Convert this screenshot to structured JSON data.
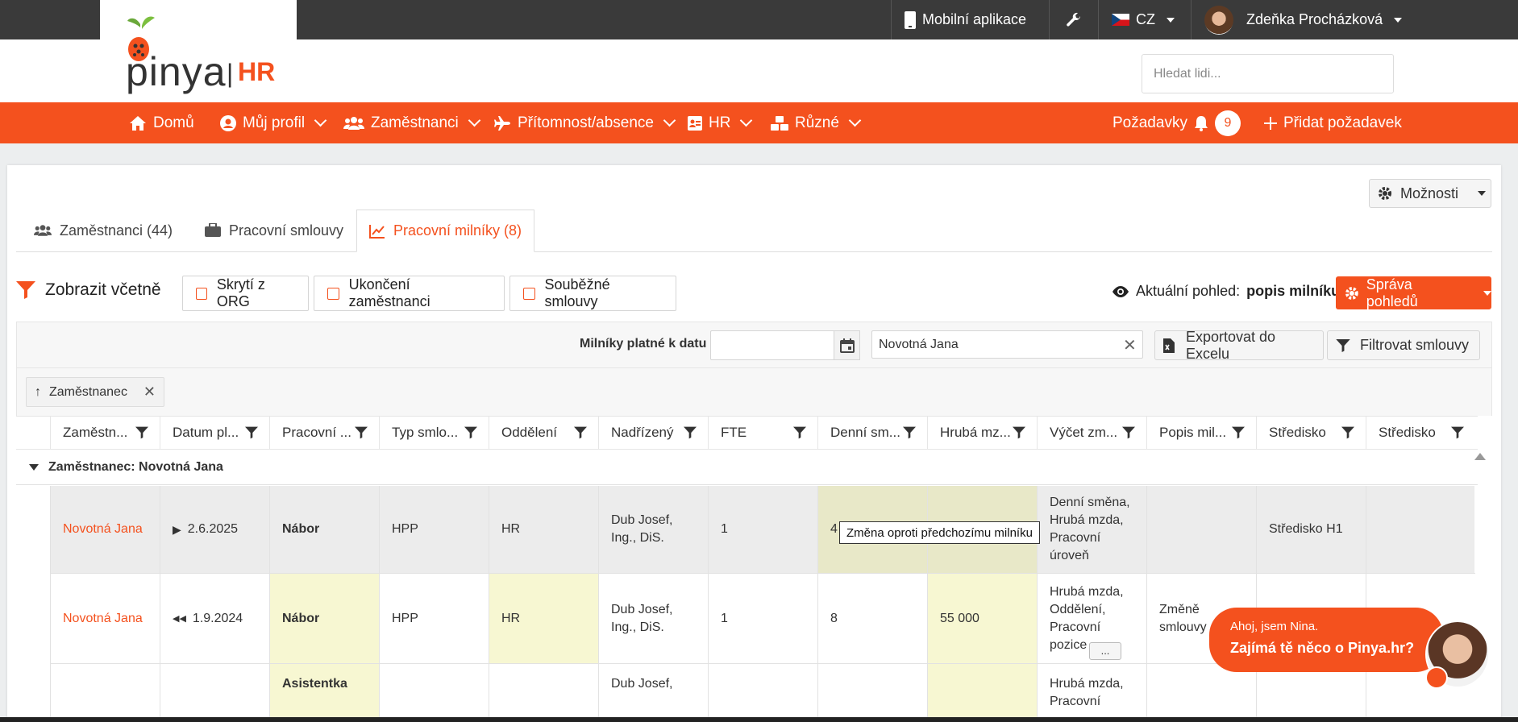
{
  "topbar": {
    "mobile_app": "Mobilní aplikace",
    "lang": "CZ",
    "user_name": "Zdeňka Procházková"
  },
  "logo": {
    "brand": "pinya",
    "suffix": "HR"
  },
  "search": {
    "placeholder": "Hledat lidi..."
  },
  "nav": {
    "items": [
      "Domů",
      "Můj profil",
      "Zaměstnanci",
      "Přítomnost/absence",
      "HR",
      "Různé"
    ],
    "requests": "Požadavky",
    "request_count": "9",
    "add_request": "Přidat požadavek"
  },
  "options_button": "Možnosti",
  "tabs": [
    "Zaměstnanci (44)",
    "Pracovní smlouvy",
    "Pracovní milníky (8)"
  ],
  "filter": {
    "title": "Zobrazit včetně",
    "checkboxes": [
      "Skrytí z ORG",
      "Ukončení zaměstnanci",
      "Souběžné smlouvy"
    ],
    "current_view_label": "Aktuální pohled:",
    "current_view_value": "popis milníku",
    "manage_views": "Správa pohledů"
  },
  "toolbar": {
    "date_label": "Milníky platné k datu",
    "date_value": "",
    "employee_filter": "Novotná Jana",
    "export": "Exportovat do Excelu",
    "filter_contracts": "Filtrovat smlouvy"
  },
  "grouping": {
    "chip": "Zaměstnanec"
  },
  "columns": [
    "Zaměstn...",
    "Datum pl...",
    "Pracovní ...",
    "Typ smlo...",
    "Oddělení",
    "Nadřízený",
    "FTE",
    "Denní sm...",
    "Hrubá mz...",
    "Výčet zm...",
    "Popis mil...",
    "Středisko",
    "Středisko"
  ],
  "group_header": "Zaměstnanec: Novotná Jana",
  "rows": [
    {
      "employee": "Novotná Jana",
      "date": "2.6.2025",
      "position": "Nábor",
      "contract": "HPP",
      "department": "HR",
      "manager": "Dub Josef,\nIng., DiS.",
      "fte": "1",
      "daily": "4",
      "gross": "",
      "changes": "Denní směna,\nHrubá mzda,\nPracovní\núroveň",
      "desc": "",
      "center": "Středisko H1",
      "center2": ""
    },
    {
      "employee": "Novotná Jana",
      "date": "1.9.2024",
      "position": "Nábor",
      "contract": "HPP",
      "department": "HR",
      "manager": "Dub Josef,\nIng., DiS.",
      "fte": "1",
      "daily": "8",
      "gross": "55 000",
      "changes": "Hrubá mzda,\nOddělení,\nPracovní\npozice",
      "desc": "Změně\nsmlouvy",
      "center": "",
      "center2": ""
    },
    {
      "employee": "",
      "date": "",
      "position": "Asistentka",
      "contract": "",
      "department": "",
      "manager": "Dub Josef,",
      "fte": "",
      "daily": "",
      "gross": "",
      "changes": "Hrubá mzda,\nPracovní",
      "desc": "",
      "center": "",
      "center2": ""
    }
  ],
  "more_button": "...",
  "tooltip": "Změna oproti předchozímu milníku",
  "chat": {
    "line1": "Ahoj, jsem Nina.",
    "line2": "Zajímá tě něco o Pinya.hr?"
  },
  "colors": {
    "accent": "#f4511e",
    "topbar": "#3a3a3a",
    "highlight": "#f7f7d2"
  }
}
